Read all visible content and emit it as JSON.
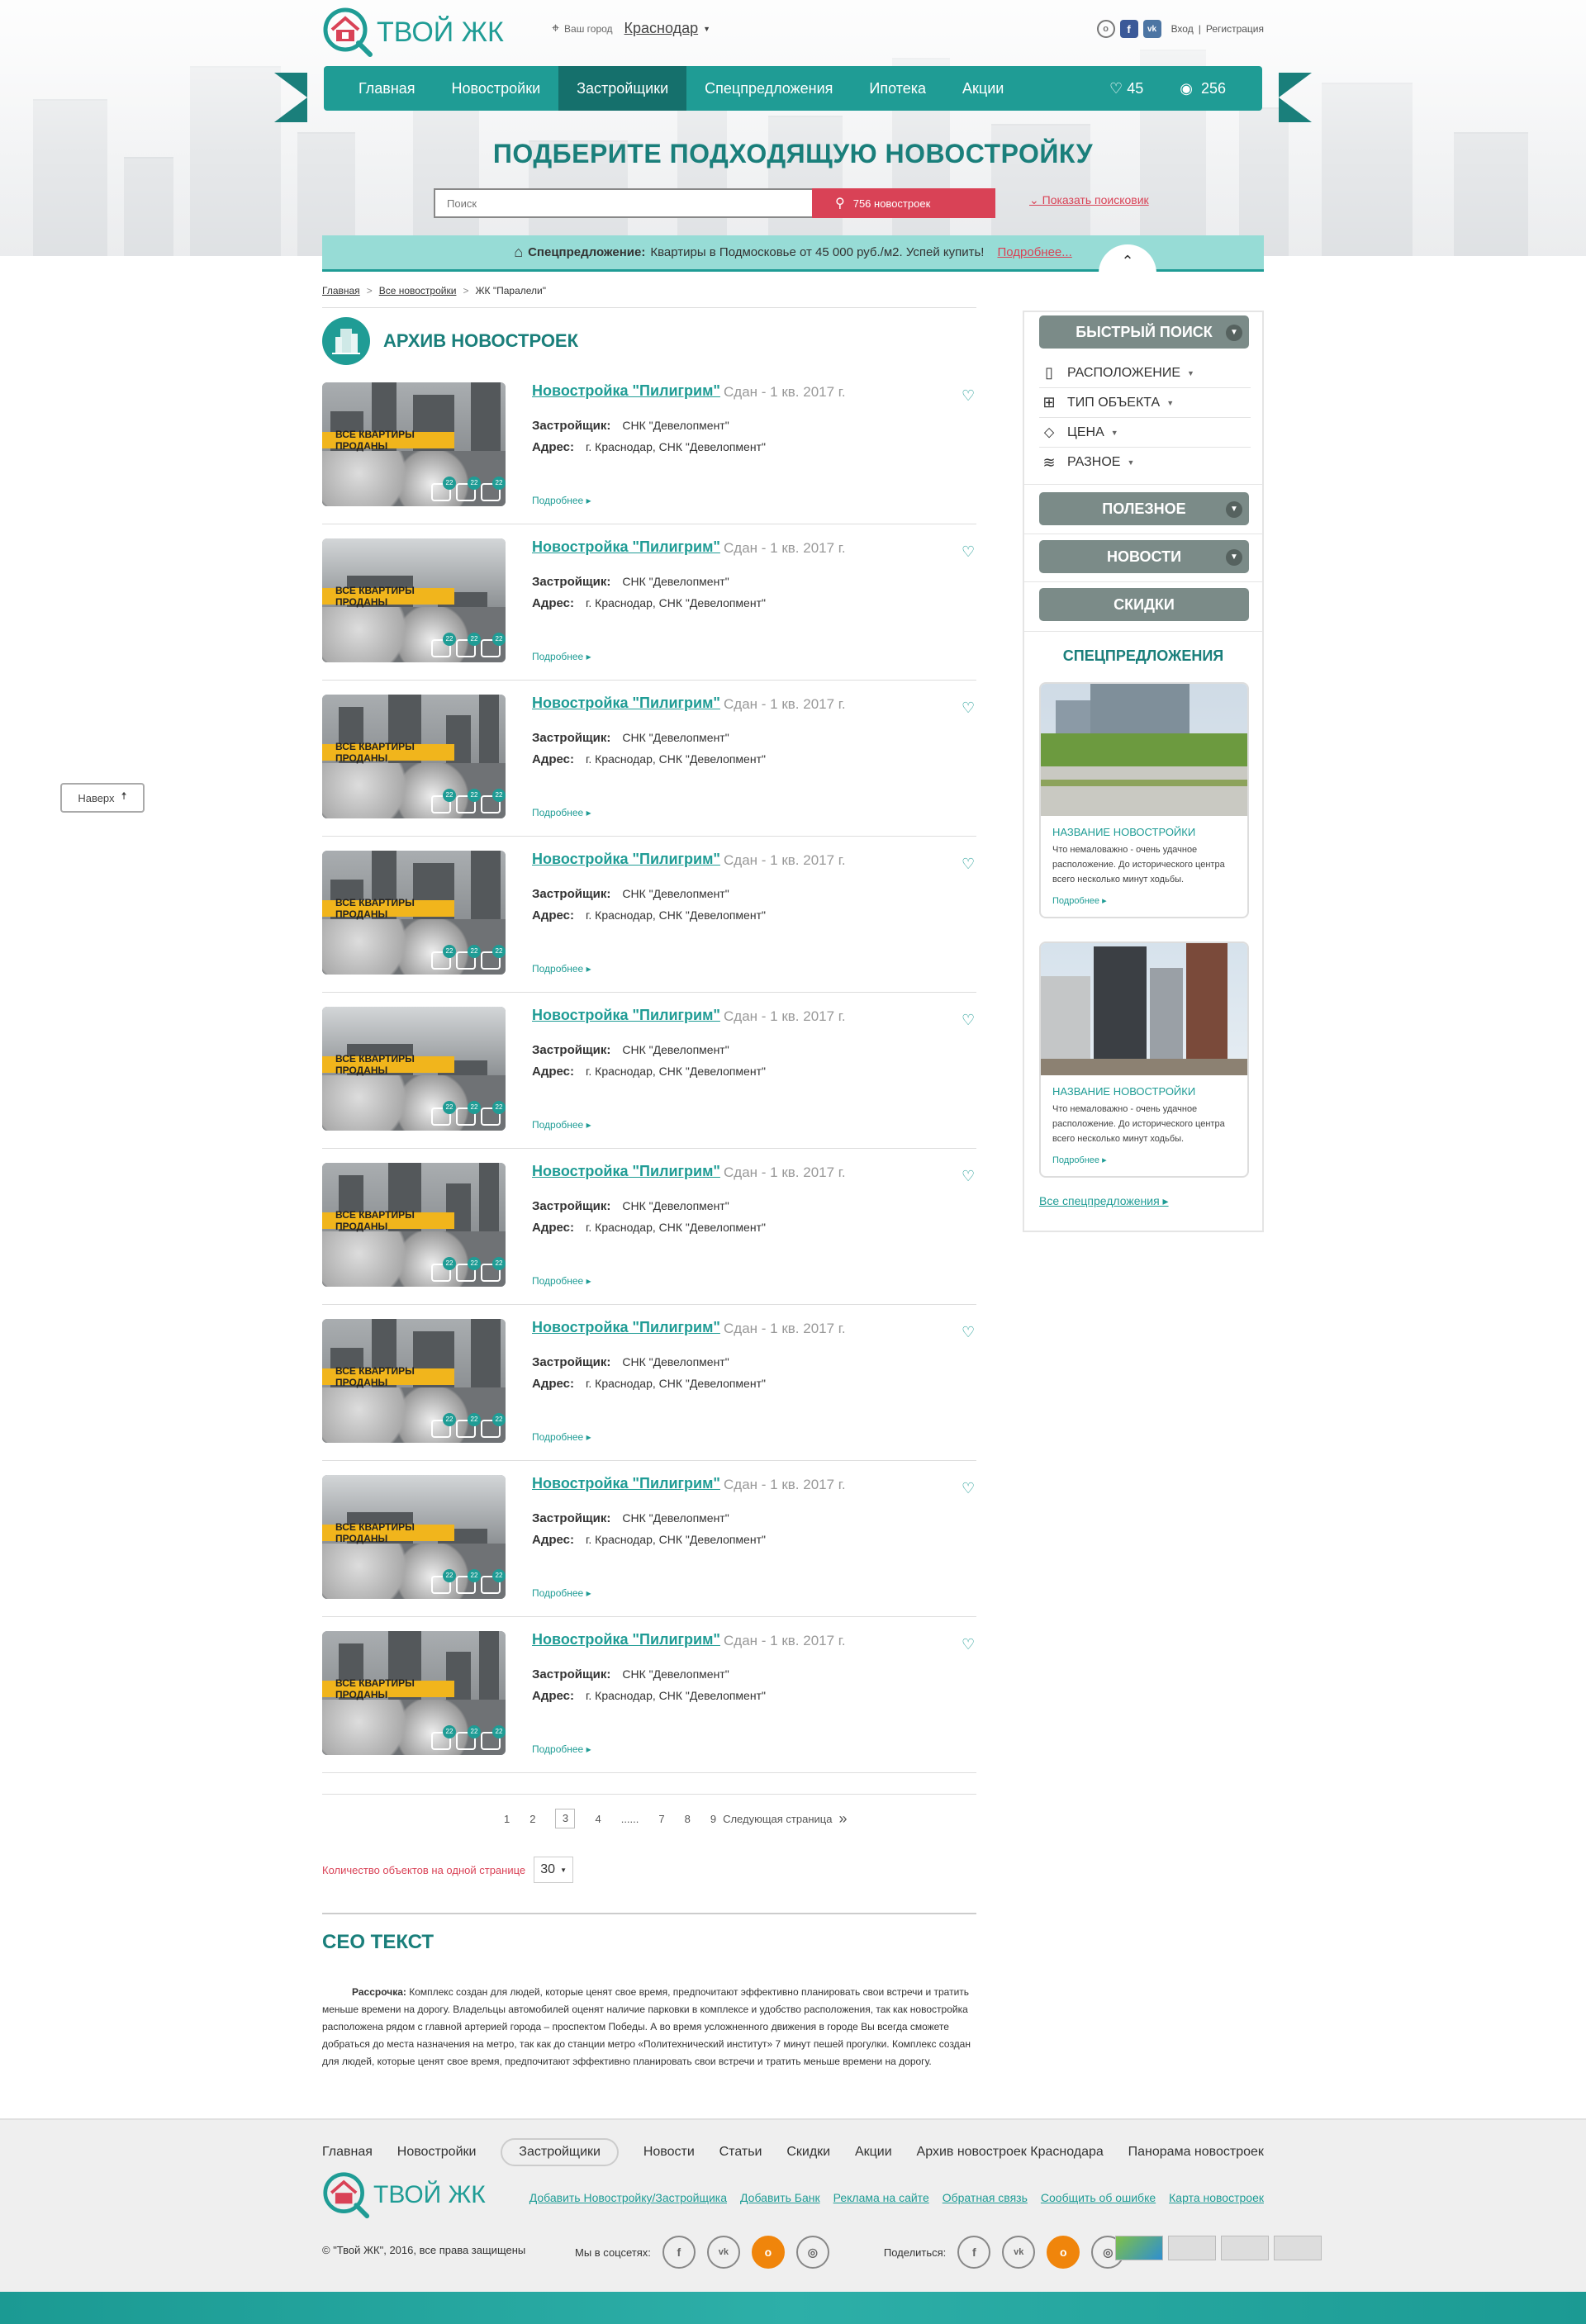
{
  "header": {
    "logo_text": "ТВОЙ ЖК",
    "city_label": "Ваш город",
    "city_value": "Краснодар",
    "login": "Вход",
    "separator": "|",
    "register": "Регистрация"
  },
  "nav": {
    "items": [
      "Главная",
      "Новостройки",
      "Застройщики",
      "Спецпредложения",
      "Ипотека",
      "Акции"
    ],
    "active_index": 2,
    "favorites_count": "45",
    "views_count": "256"
  },
  "hero": {
    "title": "ПОДБЕРИТЕ ПОДХОДЯЩУЮ НОВОСТРОЙКУ",
    "search_placeholder": "Поиск",
    "search_button": "756 новостроек",
    "show_search": "Показать поисковик"
  },
  "offer": {
    "label": "Спецпредложение:",
    "text": "Квартиры в Подмосковье от 45 000 руб./м2. Успей купить!",
    "link": "Подробнее..."
  },
  "breadcrumbs": [
    "Главная",
    "Все новостройки",
    "ЖК \"Паралели\""
  ],
  "archive": {
    "title": "АРХИВ НОВОСТРОЕК",
    "items": [
      {
        "title": "Новостройка \"Пилигрим\"",
        "date": "Сдан - 1 кв. 2017 г.",
        "builder_label": "Застройщик:",
        "builder": "СНК \"Девелопмент\"",
        "address_label": "Адрес:",
        "address": "г. Краснодар, СНК \"Девелопмент\"",
        "sold": "ВСЕ КВАРТИРЫ ПРОДАНЫ",
        "more": "Подробнее ▸",
        "photos": "22",
        "videos": "22",
        "comments": "22"
      },
      {
        "title": "Новостройка \"Пилигрим\"",
        "date": "Сдан - 1 кв. 2017 г.",
        "builder_label": "Застройщик:",
        "builder": "СНК \"Девелопмент\"",
        "address_label": "Адрес:",
        "address": "г. Краснодар, СНК \"Девелопмент\"",
        "sold": "ВСЕ КВАРТИРЫ ПРОДАНЫ",
        "more": "Подробнее ▸",
        "photos": "22",
        "videos": "22",
        "comments": "22"
      },
      {
        "title": "Новостройка \"Пилигрим\"",
        "date": "Сдан - 1 кв. 2017 г.",
        "builder_label": "Застройщик:",
        "builder": "СНК \"Девелопмент\"",
        "address_label": "Адрес:",
        "address": "г. Краснодар, СНК \"Девелопмент\"",
        "sold": "ВСЕ КВАРТИРЫ ПРОДАНЫ",
        "more": "Подробнее ▸",
        "photos": "22",
        "videos": "22",
        "comments": "22"
      },
      {
        "title": "Новостройка \"Пилигрим\"",
        "date": "Сдан - 1 кв. 2017 г.",
        "builder_label": "Застройщик:",
        "builder": "СНК \"Девелопмент\"",
        "address_label": "Адрес:",
        "address": "г. Краснодар, СНК \"Девелопмент\"",
        "sold": "ВСЕ КВАРТИРЫ ПРОДАНЫ",
        "more": "Подробнее ▸",
        "photos": "22",
        "videos": "22",
        "comments": "22"
      },
      {
        "title": "Новостройка \"Пилигрим\"",
        "date": "Сдан - 1 кв. 2017 г.",
        "builder_label": "Застройщик:",
        "builder": "СНК \"Девелопмент\"",
        "address_label": "Адрес:",
        "address": "г. Краснодар, СНК \"Девелопмент\"",
        "sold": "ВСЕ КВАРТИРЫ ПРОДАНЫ",
        "more": "Подробнее ▸",
        "photos": "22",
        "videos": "22",
        "comments": "22"
      },
      {
        "title": "Новостройка \"Пилигрим\"",
        "date": "Сдан - 1 кв. 2017 г.",
        "builder_label": "Застройщик:",
        "builder": "СНК \"Девелопмент\"",
        "address_label": "Адрес:",
        "address": "г. Краснодар, СНК \"Девелопмент\"",
        "sold": "ВСЕ КВАРТИРЫ ПРОДАНЫ",
        "more": "Подробнее ▸",
        "photos": "22",
        "videos": "22",
        "comments": "22"
      },
      {
        "title": "Новостройка \"Пилигрим\"",
        "date": "Сдан - 1 кв. 2017 г.",
        "builder_label": "Застройщик:",
        "builder": "СНК \"Девелопмент\"",
        "address_label": "Адрес:",
        "address": "г. Краснодар, СНК \"Девелопмент\"",
        "sold": "ВСЕ КВАРТИРЫ ПРОДАНЫ",
        "more": "Подробнее ▸",
        "photos": "22",
        "videos": "22",
        "comments": "22"
      },
      {
        "title": "Новостройка \"Пилигрим\"",
        "date": "Сдан - 1 кв. 2017 г.",
        "builder_label": "Застройщик:",
        "builder": "СНК \"Девелопмент\"",
        "address_label": "Адрес:",
        "address": "г. Краснодар, СНК \"Девелопмент\"",
        "sold": "ВСЕ КВАРТИРЫ ПРОДАНЫ",
        "more": "Подробнее ▸",
        "photos": "22",
        "videos": "22",
        "comments": "22"
      },
      {
        "title": "Новостройка \"Пилигрим\"",
        "date": "Сдан - 1 кв. 2017 г.",
        "builder_label": "Застройщик:",
        "builder": "СНК \"Девелопмент\"",
        "address_label": "Адрес:",
        "address": "г. Краснодар, СНК \"Девелопмент\"",
        "sold": "ВСЕ КВАРТИРЫ ПРОДАНЫ",
        "more": "Подробнее ▸",
        "photos": "22",
        "videos": "22",
        "comments": "22"
      }
    ]
  },
  "pagination": {
    "pages": [
      "1",
      "2",
      "3",
      "4",
      "......",
      "7",
      "8",
      "9"
    ],
    "current": "3",
    "next": "Следующая страница",
    "next_icon": "»"
  },
  "per_page": {
    "label": "Количество объектов на одной странице",
    "value": "30"
  },
  "seo": {
    "title": "СЕО ТЕКСТ",
    "lead": "Рассрочка:",
    "text": "Комплекс создан для людей, которые ценят свое время, предпочитают эффективно планировать свои встречи и тратить меньше времени на дорогу. Владельцы автомобилей оценят наличие парковки в комплексе и удобство расположения, так как новостройка расположена рядом с главной артерией города – проспектом Победы. А во время усложненного движения в городе Вы всегда сможете добраться до места назначения на метро, так как до станции метро «Политехнический институт» 7 минут пешей прогулки. Комплекс создан для людей, которые ценят свое время, предпочитают эффективно планировать свои встречи и тратить меньше времени на дорогу."
  },
  "sidebar": {
    "quick_search": "БЫСТРЫЙ ПОИСК",
    "filters": [
      {
        "label": "РАСПОЛОЖЕНИЕ",
        "icon": "map-icon"
      },
      {
        "label": "ТИП ОБЪЕКТА",
        "icon": "grid-icon"
      },
      {
        "label": "ЦЕНА",
        "icon": "tag-icon"
      },
      {
        "label": "РАЗНОЕ",
        "icon": "layers-icon"
      }
    ],
    "useful": "ПОЛЕЗНОЕ",
    "news": "НОВОСТИ",
    "discounts": "СКИДКИ",
    "offers_title": "СПЕЦПРЕДЛОЖЕНИЯ",
    "cards": [
      {
        "name": "НАЗВАНИЕ НОВОСТРОЙКИ",
        "desc": "Что немаловажно - очень удачное расположение. До исторического центра всего несколько минут ходьбы.",
        "more": "Подробнее ▸"
      },
      {
        "name": "НАЗВАНИЕ НОВОСТРОЙКИ",
        "desc": "Что немаловажно - очень удачное расположение. До исторического центра всего несколько минут ходьбы.",
        "more": "Подробнее ▸"
      }
    ],
    "all_offers": "Все спецпредложения ▸"
  },
  "to_top": "Наверх",
  "footer": {
    "nav": [
      "Главная",
      "Новостройки",
      "Застройщики",
      "Новости",
      "Статьи",
      "Скидки",
      "Акции",
      "Архив новостроек Краснодара",
      "Панорама новостроек"
    ],
    "active_index": 2,
    "logo_text": "ТВОЙ ЖК",
    "links": [
      "Добавить Новостройку/Застройщика",
      "Добавить Банк",
      "Реклама на сайте",
      "Обратная связь",
      "Сообщить об ошибке",
      "Карта новостроек"
    ],
    "copyright": "© \"Твой ЖК\", 2016, все права защищены",
    "social_label": "Мы в соцсетях:",
    "share_label": "Поделиться:"
  },
  "colors": {
    "accent": "#1f9c95",
    "accent_dark": "#1a7f7b",
    "danger": "#d94256",
    "sold_badge": "#f1b51c"
  }
}
